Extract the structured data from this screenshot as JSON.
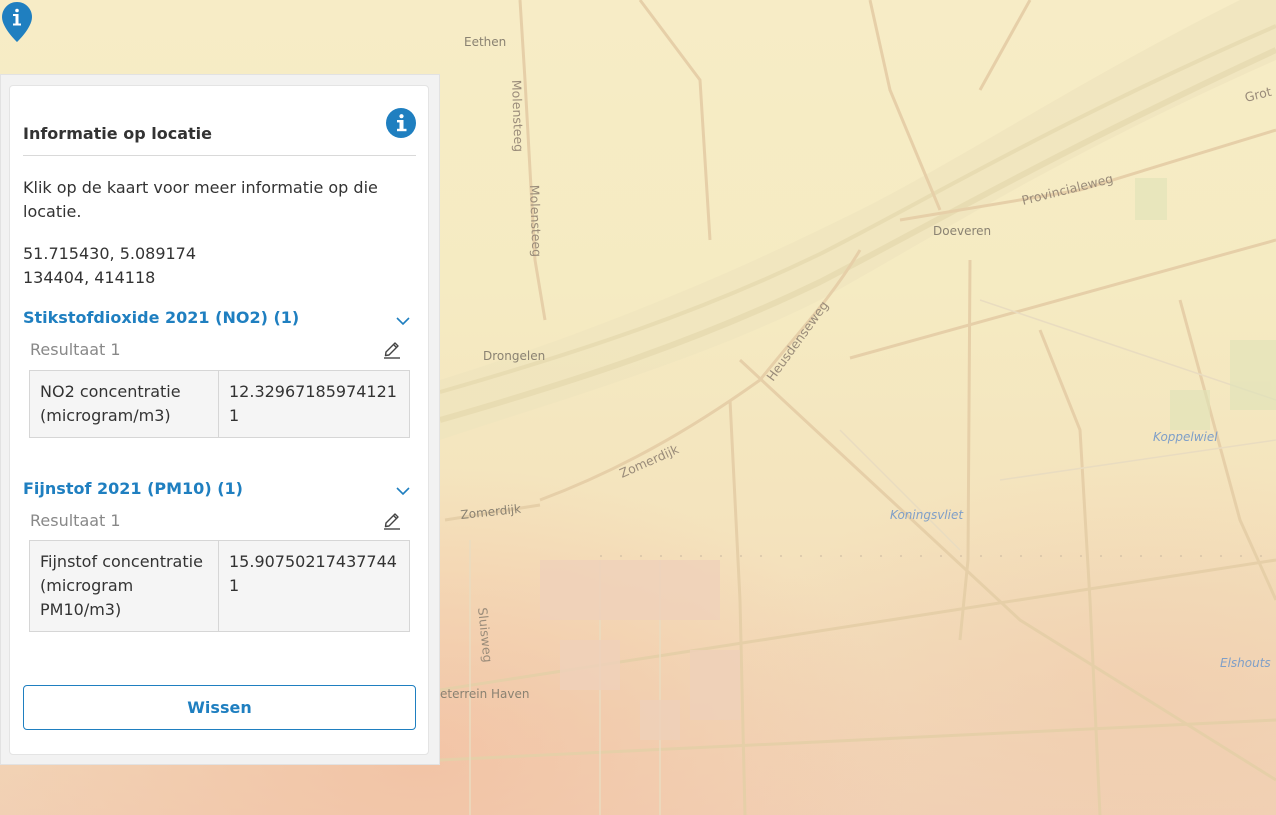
{
  "map": {
    "places": {
      "eethen": "Eethen",
      "doeveren": "Doeveren",
      "drongelen": "Drongelen",
      "zomerdijk": "Zomerdijk",
      "bedrijventerrein": "eterrein Haven"
    },
    "roads": {
      "molensteeg_1": "Molensteeg",
      "molensteeg_2": "Molensteeg",
      "provincialeweg": "Provincialeweg",
      "heusdenseweg": "Heusdenseweg",
      "zomerdijk_road": "Zomerdijk",
      "sluisweg": "Sluisweg",
      "groot": "Grot"
    },
    "water": {
      "koppelwiel": "Koppelwiel",
      "koningsvliet": "Koningsvliet",
      "elshout": "Elshouts"
    },
    "marker_icon": "info-marker-icon"
  },
  "panel": {
    "title": "Informatie op locatie",
    "info_icon": "info-icon",
    "intro": "Klik op de kaart voor meer informatie op die locatie.",
    "coords_wgs84": "51.715430, 5.089174",
    "coords_rd": "134404, 414118",
    "accent_color": "#1f7fc0",
    "sections": [
      {
        "title": "Stikstofdioxide 2021 (NO2) (1)",
        "result_label": "Resultaat 1",
        "rows": [
          {
            "key": "NO2 concentratie (microgram/m3)",
            "value": "12.329671859741211"
          }
        ]
      },
      {
        "title": "Fijnstof 2021 (PM10) (1)",
        "result_label": "Resultaat 1",
        "rows": [
          {
            "key": "Fijnstof concentratie (microgram PM10/m3)",
            "value": "15.907502174377441"
          }
        ]
      }
    ],
    "clear_label": "Wissen"
  }
}
